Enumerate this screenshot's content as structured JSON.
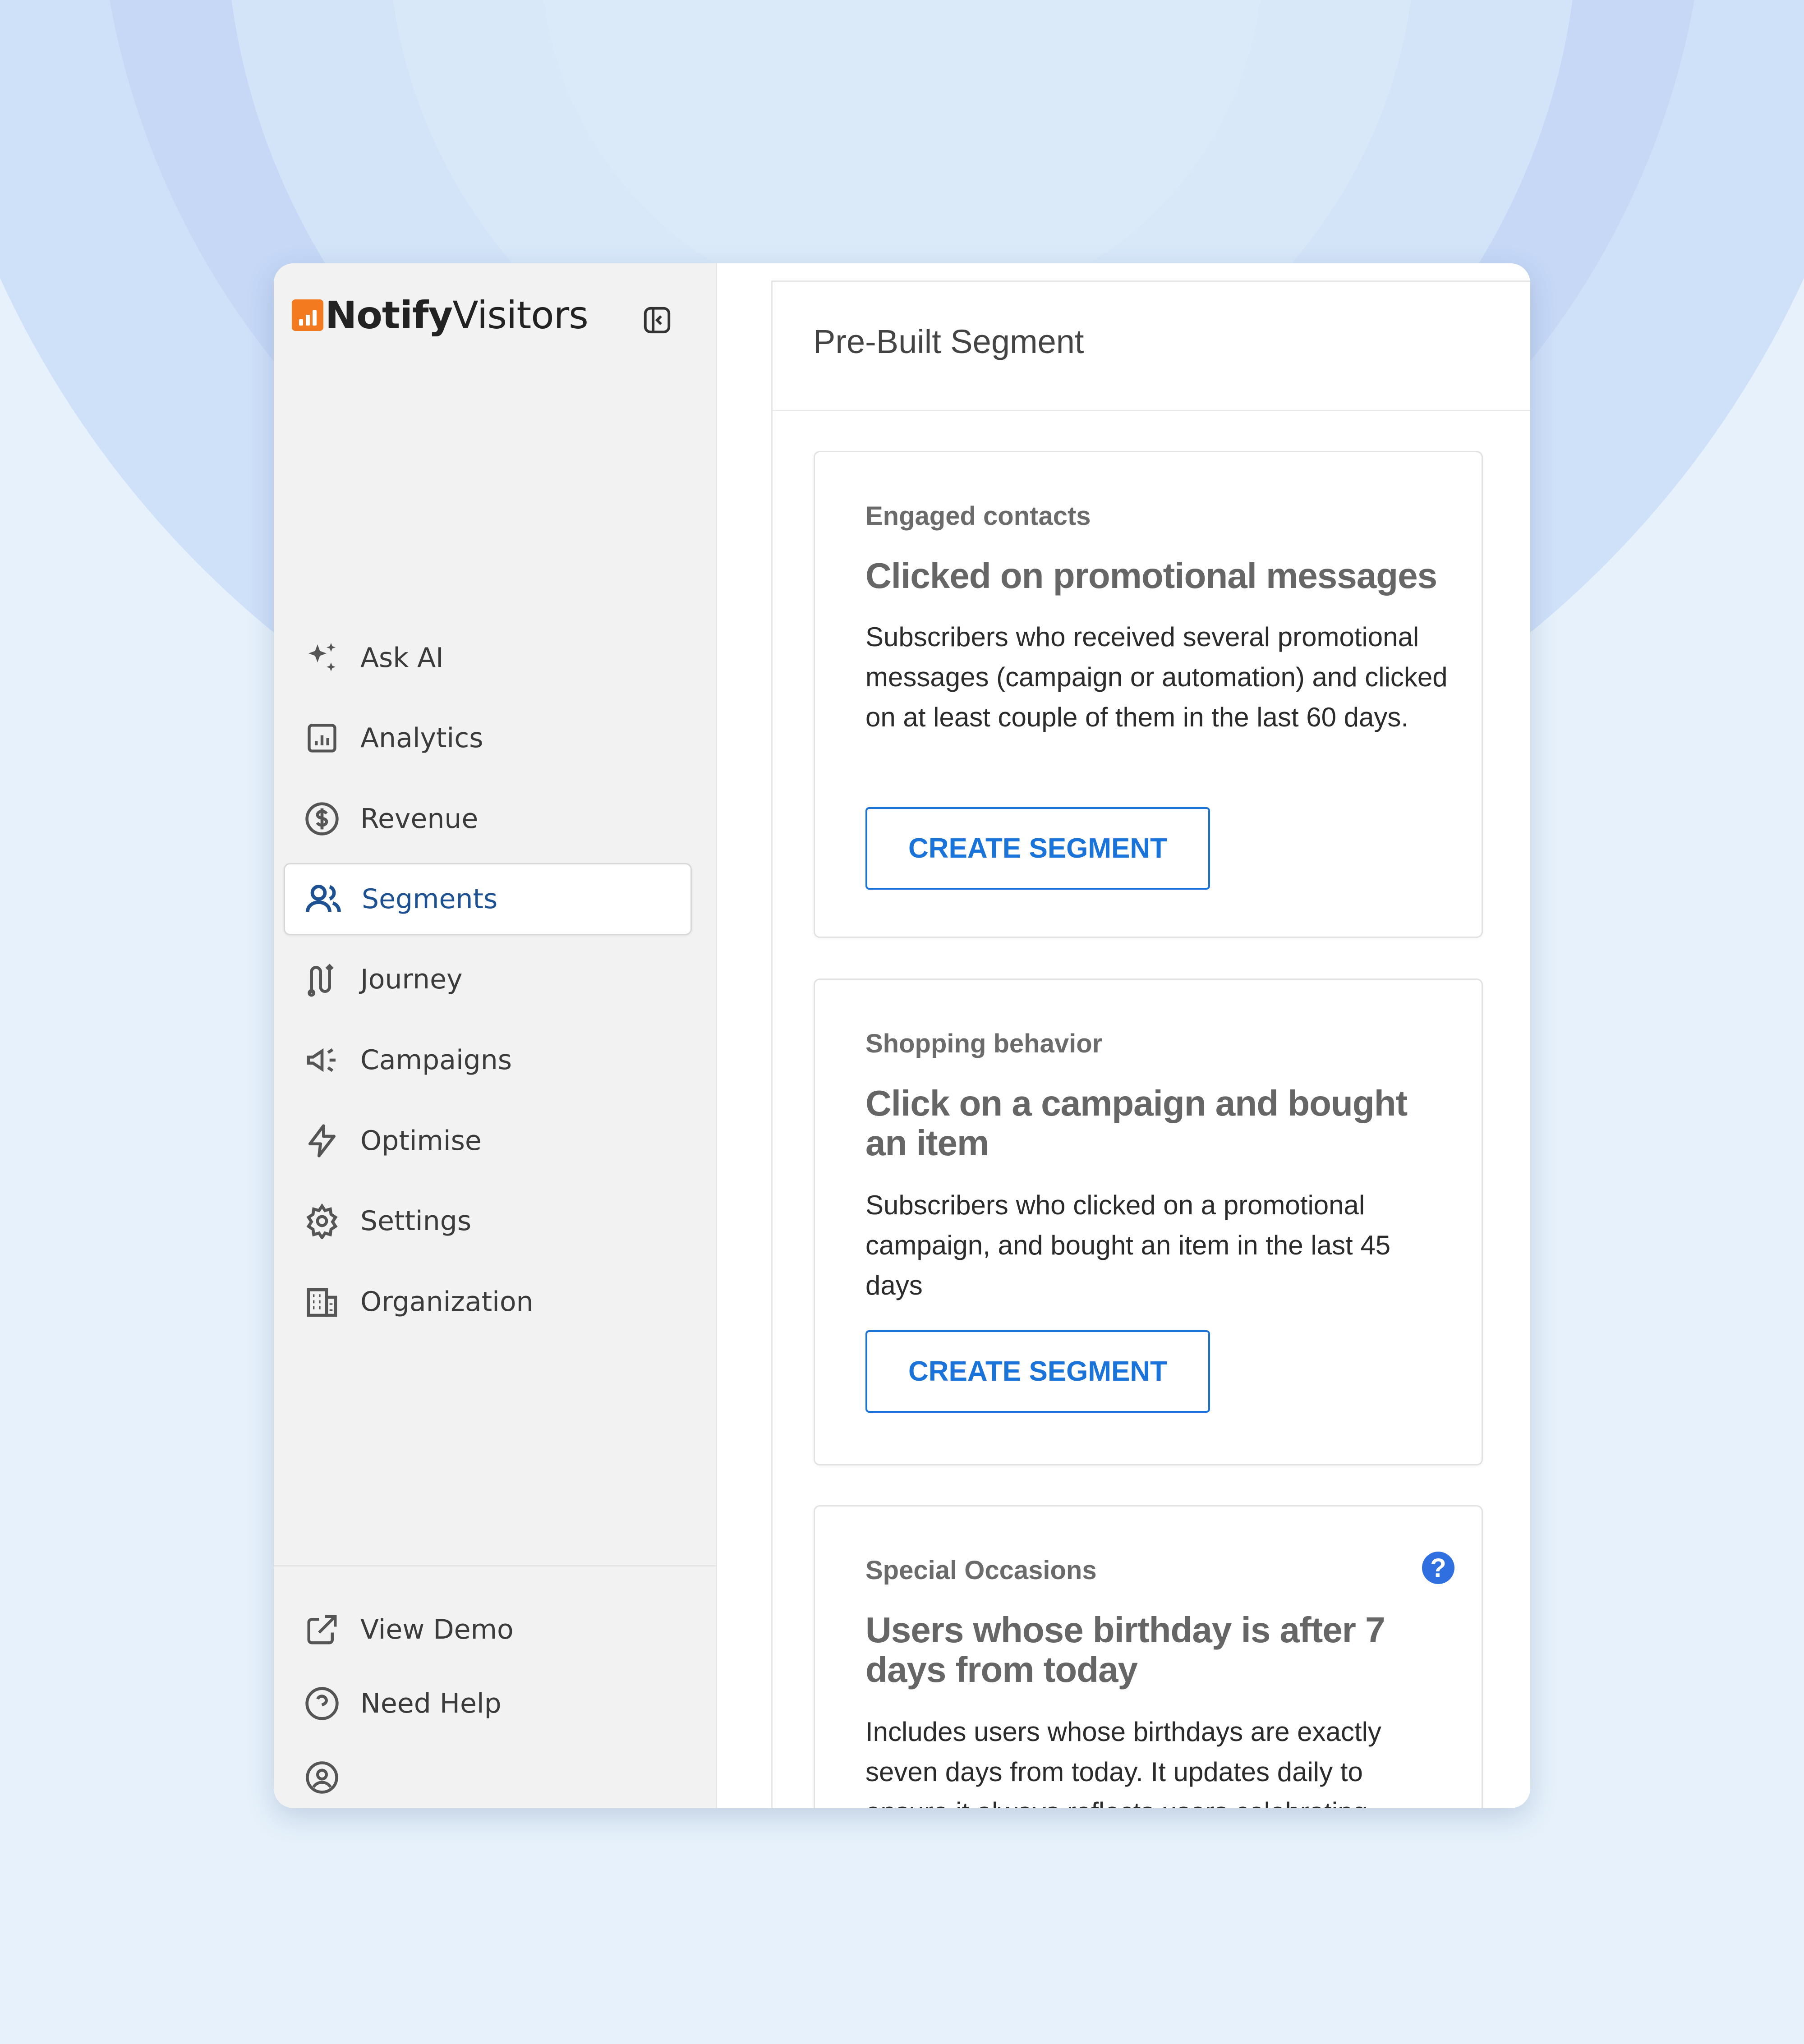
{
  "brand": {
    "name_bold": "Notify",
    "name_light": "Visitors",
    "logo_color": "#f47a20"
  },
  "sidebar": {
    "items": [
      {
        "label": "Ask AI",
        "icon": "sparkles-icon"
      },
      {
        "label": "Analytics",
        "icon": "bar-chart-icon"
      },
      {
        "label": "Revenue",
        "icon": "dollar-circle-icon"
      },
      {
        "label": "Segments",
        "icon": "users-icon",
        "active": true
      },
      {
        "label": "Journey",
        "icon": "route-icon"
      },
      {
        "label": "Campaigns",
        "icon": "megaphone-icon"
      },
      {
        "label": "Optimise",
        "icon": "lightning-icon"
      },
      {
        "label": "Settings",
        "icon": "gear-icon"
      },
      {
        "label": "Organization",
        "icon": "building-icon"
      }
    ],
    "bottom": [
      {
        "label": "View Demo",
        "icon": "external-link-icon"
      },
      {
        "label": "Need Help",
        "icon": "question-circle-icon"
      },
      {
        "label": "",
        "icon": "user-circle-icon"
      }
    ],
    "active_color": "#1e5192"
  },
  "main": {
    "title": "Pre-Built Segment",
    "cards": [
      {
        "category": "Engaged contacts",
        "title": "Clicked on promotional messages",
        "description": "Subscribers who received several promotional messages (campaign or automation) and clicked on at least couple of them in the last 60 days.",
        "button": "CREATE SEGMENT"
      },
      {
        "category": "Shopping behavior",
        "title": "Click on a campaign and bought an item",
        "description": "Subscribers who clicked on a promotional campaign, and bought an item in the last 45 days",
        "button": "CREATE SEGMENT"
      },
      {
        "category": "Special Occasions",
        "title": "Users whose birthday is after 7 days from today",
        "description": "Includes users whose birthdays are exactly seven days from today. It updates daily to ensure it always reflects users celebrating",
        "help": "?"
      }
    ],
    "accent_color": "#1a73d9"
  }
}
